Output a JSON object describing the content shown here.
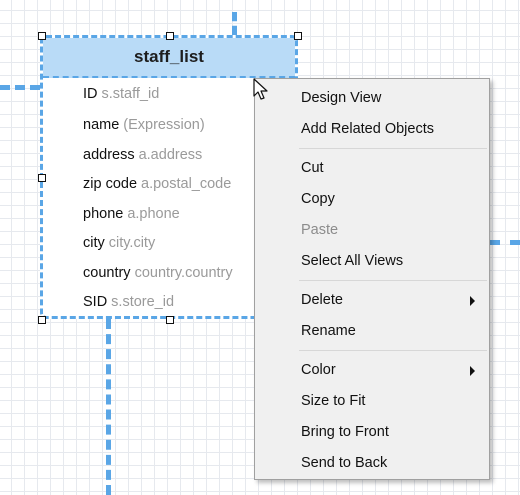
{
  "table": {
    "title": "staff_list",
    "fields": [
      {
        "name": "ID",
        "source": "s.staff_id"
      },
      {
        "name": "name",
        "source": "(Expression)"
      },
      {
        "name": "address",
        "source": "a.address"
      },
      {
        "name": "zip code",
        "source": "a.postal_code"
      },
      {
        "name": "phone",
        "source": "a.phone"
      },
      {
        "name": "city",
        "source": "city.city"
      },
      {
        "name": "country",
        "source": "country.country"
      },
      {
        "name": "SID",
        "source": "s.store_id"
      }
    ]
  },
  "context_menu": {
    "groups": [
      [
        {
          "label": "Design View"
        },
        {
          "label": "Add Related Objects"
        }
      ],
      [
        {
          "label": "Cut"
        },
        {
          "label": "Copy"
        },
        {
          "label": "Paste",
          "disabled": true
        },
        {
          "label": "Select All Views"
        }
      ],
      [
        {
          "label": "Delete",
          "submenu": true
        },
        {
          "label": "Rename"
        }
      ],
      [
        {
          "label": "Color",
          "submenu": true
        },
        {
          "label": "Size to Fit"
        },
        {
          "label": "Bring to Front"
        },
        {
          "label": "Send to Back"
        }
      ]
    ]
  },
  "colors": {
    "accent": "#5aa6e6",
    "header_fill": "#b9dbf7",
    "menu_bg": "#f0f0f0",
    "muted_text": "#9a9a9a"
  }
}
